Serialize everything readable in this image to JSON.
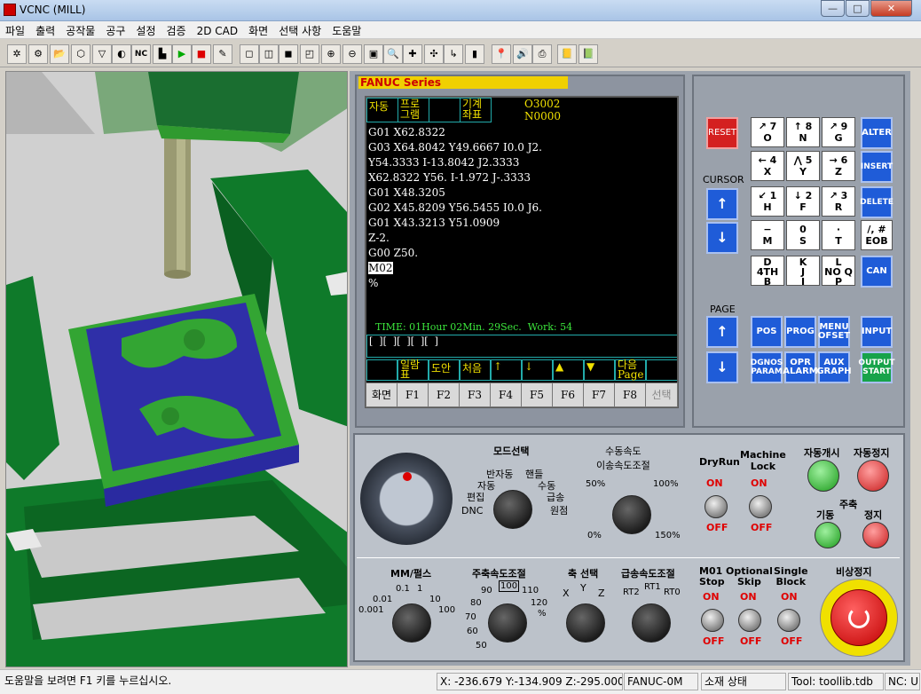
{
  "window": {
    "title": "VCNC (MILL)",
    "min": "—",
    "max": "□",
    "close": "✕"
  },
  "menu": [
    "파일",
    "출력",
    "공작물",
    "공구",
    "설정",
    "검증",
    "2D CAD",
    "화면",
    "선택 사항",
    "도움말"
  ],
  "toolbar": [
    "✲",
    "⚙",
    "📂",
    "⬡",
    "▽",
    "◐",
    "NC",
    "▙",
    "▶",
    "■",
    "✎",
    "◻",
    "◫",
    "◼",
    "◰",
    "⊕",
    "⊖",
    "▣",
    "🔍",
    "✚",
    "✣",
    "↳",
    "▮",
    "📍",
    "🔊",
    "⎙",
    "📒",
    "📗"
  ],
  "screen": {
    "header": "FANUC  Series",
    "tabs": [
      "자동",
      "프로\n그램",
      "",
      "기계\n좌표"
    ],
    "program": "O3002",
    "sequence": "N0000",
    "lines": [
      "G01 X62.8322",
      "G03 X64.8042 Y49.6667 I0.0 J2.",
      "Y54.3333 I-13.8042 J2.3333",
      "X62.8322 Y56. I-1.972 J-.3333",
      "G01 X48.3205",
      "G02 X45.8209 Y56.5455 I0.0 J6.",
      "G01 X43.3213 Y51.0909",
      "Z-2.",
      "G00 Z50.",
      "M02",
      "%"
    ],
    "time": "TIME: 01Hour 02Min. 29Sec.  Work: 54",
    "input": "[  ][  ][  ][  ][  ]",
    "upper_softkeys": [
      "",
      "일람\n표",
      "도안",
      "처음",
      "↑",
      "↓",
      "▲",
      "▼",
      "다음\nPage",
      ""
    ],
    "softkeys": [
      "화면",
      "F1",
      "F2",
      "F3",
      "F4",
      "F5",
      "F6",
      "F7",
      "F8",
      "선택"
    ]
  },
  "keypad": {
    "reset": "RESET",
    "cursor": "CURSOR",
    "page": "PAGE",
    "up": "↑",
    "down": "↓",
    "keys": [
      [
        "↗ 7\nO",
        "↑ 8\nN",
        "↗ 9\nG"
      ],
      [
        "← 4\nX",
        "⋀ 5\nY",
        "→ 6\nZ"
      ],
      [
        "↙ 1\nH",
        "↓ 2\nF",
        "↗ 3\nR"
      ],
      [
        "−\nM",
        "0\nS",
        "·\nT"
      ],
      [
        "D\n4TH\nB",
        "K\nJ\nI",
        "L\nNO Q\nP"
      ]
    ],
    "right": [
      "ALTER",
      "INSERT",
      "DELETE",
      "/, #\nEOB",
      "CAN"
    ],
    "func": [
      "POS",
      "PROG",
      "MENU\nOFSET",
      "INPUT",
      "DGNOS\nPARAM",
      "OPR\nALARM",
      "AUX\nGRAPH",
      "OUTPUT\nSTART"
    ]
  },
  "panel": {
    "mode_title": "모드선택",
    "mode_opts": [
      "반자동",
      "핸들",
      "자동",
      "수동",
      "편집",
      "급송",
      "DNC",
      "원점"
    ],
    "feed_title": "수동속도\n이송속도조절",
    "feed_ticks": [
      "50%",
      "100%",
      "0%",
      "150%"
    ],
    "dryrun": "DryRun",
    "mlock": "Machine\nLock",
    "on": "ON",
    "off": "OFF",
    "auto_start": "자동개시",
    "auto_stop": "자동정지",
    "spindle": "주축",
    "spindle_start": "기동",
    "spindle_stop": "정지",
    "mm_title": "MM/펄스",
    "mm_ticks": [
      "0.1",
      "1",
      "0.01",
      "10",
      "0.001",
      "100"
    ],
    "spspeed_title": "주축속도조절",
    "spspeed_ticks": [
      "90",
      "100",
      "110",
      "80",
      "120",
      "70",
      "%",
      "60",
      "50"
    ],
    "axis_title": "축 선택",
    "axis_opts": [
      "X",
      "Y",
      "Z"
    ],
    "rapid_title": "급송속도조절",
    "rapid_opts": [
      "RT2",
      "RT1",
      "RT0"
    ],
    "m01": "M01\nStop",
    "optskip": "Optional\nSkip",
    "single": "Single\nBlock",
    "estop": "비상정지"
  },
  "status": {
    "help": "도움말을 보려면 F1 키를 누르십시오.",
    "coords": "X: -236.679  Y:-134.909  Z:-295.000",
    "controller": "FANUC-0M",
    "material": "소재 상태",
    "tool": "Tool: toollib.tdb",
    "nc": "NC: U"
  }
}
